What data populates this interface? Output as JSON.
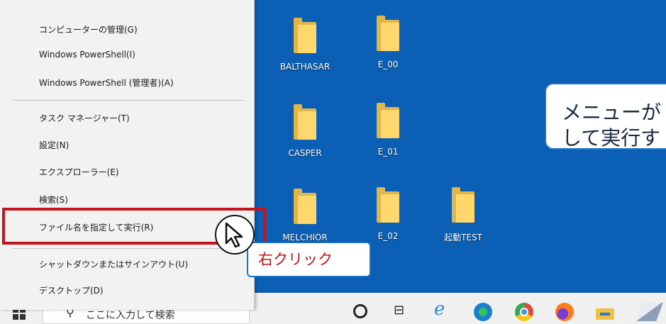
{
  "menu": {
    "items": [
      "コンピューターの管理(G)",
      "Windows PowerShell(I)",
      "Windows PowerShell (管理者)(A)",
      "タスク マネージャー(T)",
      "設定(N)",
      "エクスプローラー(E)",
      "検索(S)",
      "ファイル名を指定して実行(R)",
      "シャットダウンまたはサインアウト(U)",
      "デスクトップ(D)"
    ]
  },
  "desktop": {
    "icons": [
      "BALTHASAR",
      "E_00",
      "CASPER",
      "E_01",
      "MELCHIOR",
      "E_02",
      "起動TEST"
    ]
  },
  "callouts": {
    "right_line1": "メニューが",
    "right_line2": "して実行す",
    "click": "右クリック"
  },
  "taskbar": {
    "search_placeholder": "ここに入力して検索"
  },
  "colors": {
    "desktop": "#0b60b6",
    "highlight": "#c4151c",
    "callout_border": "#1e73c9"
  }
}
